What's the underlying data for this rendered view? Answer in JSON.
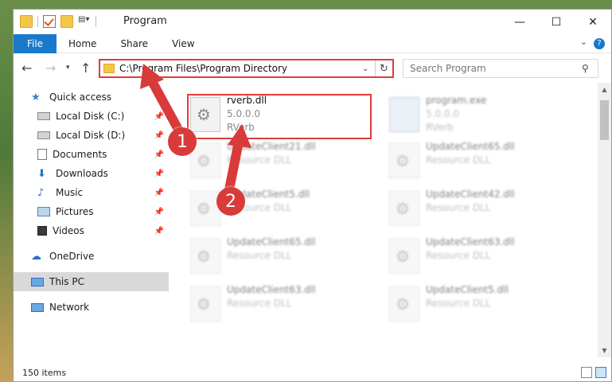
{
  "window": {
    "title": "Program",
    "controls": {
      "minimize": "—",
      "maximize": "☐",
      "close": "✕"
    }
  },
  "ribbon": {
    "tabs": [
      {
        "label": "File"
      },
      {
        "label": "Home"
      },
      {
        "label": "Share"
      },
      {
        "label": "View"
      }
    ],
    "expand_icon": "chevron-down-icon",
    "help_icon": "help-icon"
  },
  "address_bar": {
    "path": "C:\\Program Files\\Program Directory",
    "search_placeholder": "Search Program",
    "highlight_color": "#e03b3b"
  },
  "nav": {
    "items": [
      {
        "label": "Quick access",
        "icon": "star-icon",
        "pinned": false
      },
      {
        "label": "Local Disk (C:)",
        "icon": "drive-icon",
        "pinned": true
      },
      {
        "label": "Local Disk (D:)",
        "icon": "drive-icon",
        "pinned": true
      },
      {
        "label": "Documents",
        "icon": "documents-icon",
        "pinned": true
      },
      {
        "label": "Downloads",
        "icon": "download-icon",
        "pinned": true
      },
      {
        "label": "Music",
        "icon": "music-icon",
        "pinned": true
      },
      {
        "label": "Pictures",
        "icon": "pictures-icon",
        "pinned": true
      },
      {
        "label": "Videos",
        "icon": "videos-icon",
        "pinned": true
      },
      {
        "label": "OneDrive",
        "icon": "cloud-icon",
        "pinned": false
      },
      {
        "label": "This PC",
        "icon": "computer-icon",
        "pinned": false,
        "selected": true
      },
      {
        "label": "Network",
        "icon": "network-icon",
        "pinned": false
      }
    ]
  },
  "files": {
    "left_column": [
      {
        "name": "rverb.dll",
        "sub1": "5.0.0.0",
        "sub2": "RVerb",
        "highlighted": true
      },
      {
        "name": "UpdateClient21.dll",
        "sub1": "Resource DLL"
      },
      {
        "name": "UpdateClient5.dll",
        "sub1": "Resource DLL"
      },
      {
        "name": "UpdateClient65.dll",
        "sub1": "Resource DLL"
      },
      {
        "name": "UpdateClient63.dll",
        "sub1": "Resource DLL"
      }
    ],
    "right_column": [
      {
        "name": "program.exe",
        "sub1": "5.0.0.0",
        "sub2": "RVerb"
      },
      {
        "name": "UpdateClient65.dll",
        "sub1": "Resource DLL"
      },
      {
        "name": "UpdateClient42.dll",
        "sub1": "Resource DLL"
      },
      {
        "name": "UpdateClient63.dll",
        "sub1": "Resource DLL"
      },
      {
        "name": "UpdateClient5.dll",
        "sub1": "Resource DLL"
      }
    ]
  },
  "status": {
    "item_count": "150 items"
  },
  "annotations": {
    "step1": "1",
    "step2": "2",
    "color": "#d93a3a"
  }
}
